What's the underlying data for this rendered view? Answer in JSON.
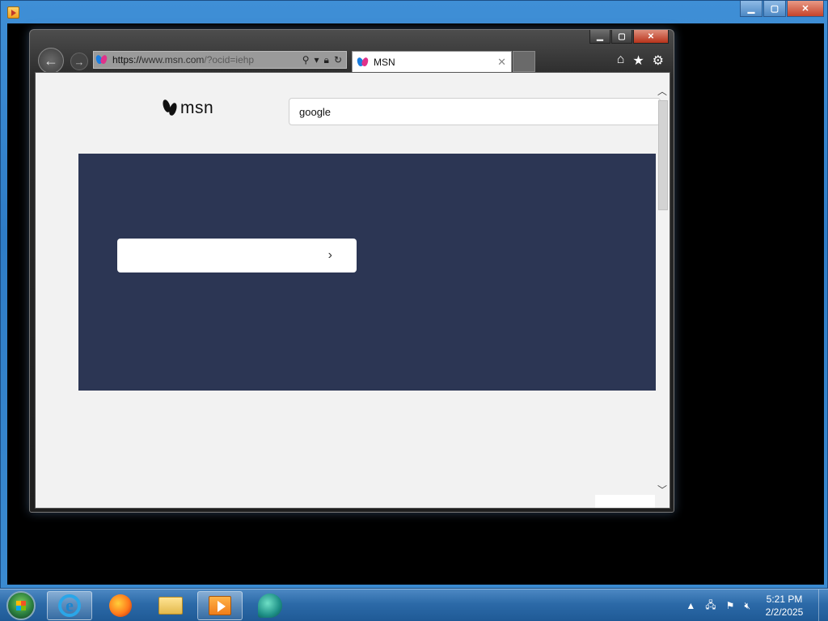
{
  "outer_window": {
    "controls": {
      "minimize": "▁",
      "maximize": "▢",
      "close": "✕"
    }
  },
  "ie_window": {
    "controls": {
      "minimize": "▁",
      "maximize": "▢",
      "close": "✕"
    }
  },
  "address_bar": {
    "url_prefix": "https://",
    "url_host": "www.msn.com",
    "url_rest": "/?ocid=iehp",
    "icons": [
      "search-icon",
      "dropdown-icon",
      "lock-icon",
      "refresh-icon"
    ]
  },
  "tab": {
    "title": "MSN",
    "close": "✕"
  },
  "toolbar": {
    "icons": [
      "home-icon",
      "favorites-icon",
      "settings-icon"
    ]
  },
  "page": {
    "logo_text": "msn",
    "search_value": "google",
    "hero_arrow": "›"
  },
  "scrollbar": {
    "up": "︿",
    "down": "﹀"
  },
  "taskbar": {
    "pinned": [
      "internet-explorer",
      "firefox",
      "windows-explorer",
      "media-player",
      "app"
    ],
    "clock_time": "5:21 PM",
    "clock_date": "2/2/2025",
    "tray_icons": [
      "show-hidden-icons",
      "network-icon",
      "action-center-flag-icon",
      "volume-muted-icon"
    ]
  },
  "colors": {
    "hero_bg": "#2c3654",
    "page_bg": "#f2f2f2",
    "taskbar": "#2c6aa8"
  }
}
